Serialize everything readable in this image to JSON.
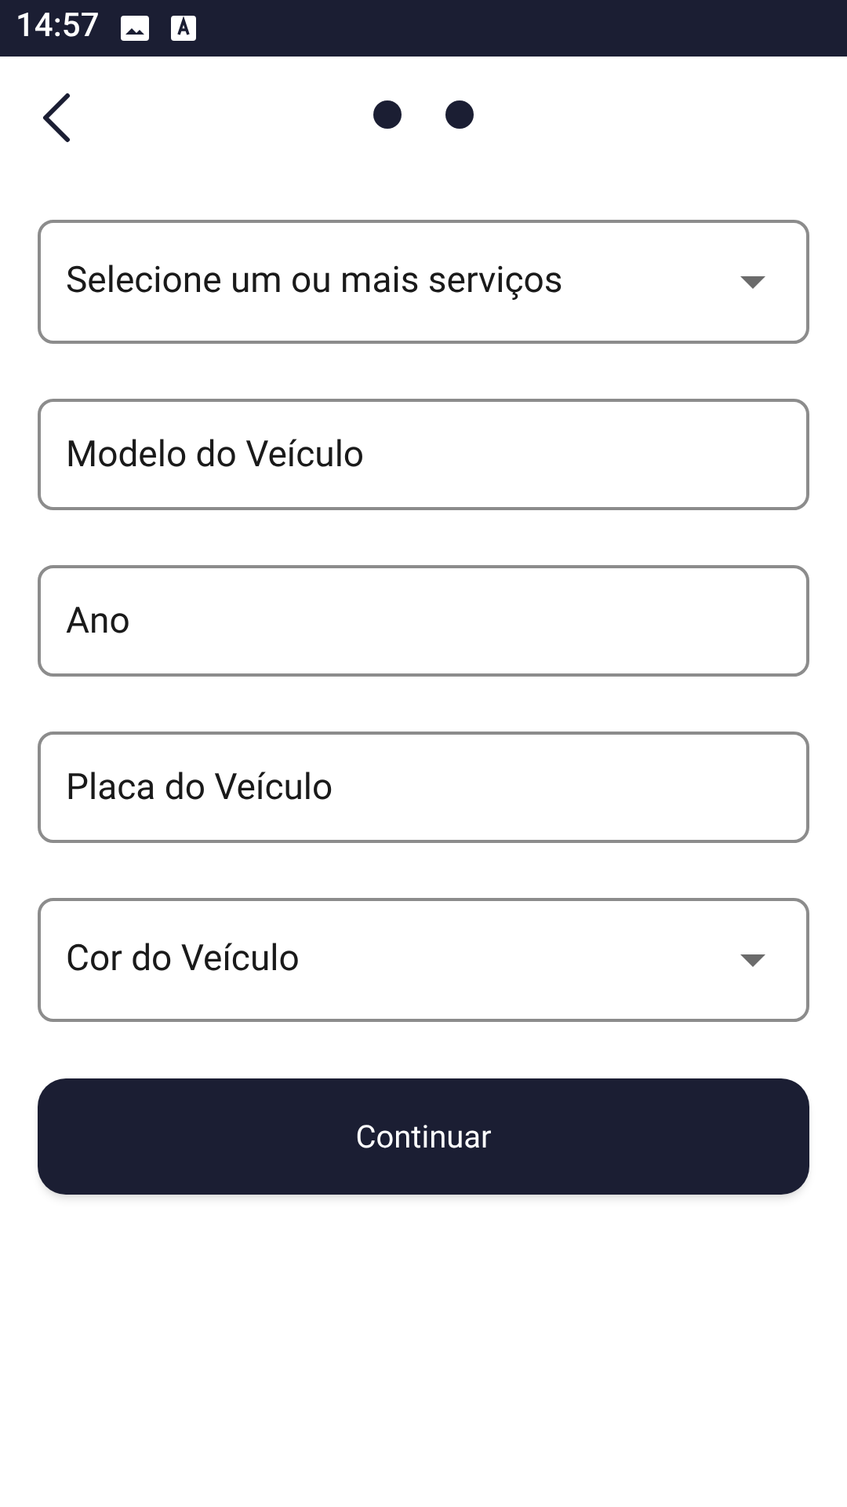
{
  "status_bar": {
    "time": "14:57"
  },
  "fields": [
    {
      "kind": "dropdown",
      "placeholder": "Selecione um ou mais serviços"
    },
    {
      "kind": "text",
      "placeholder": "Modelo do Veículo"
    },
    {
      "kind": "text",
      "placeholder": "Ano"
    },
    {
      "kind": "text",
      "placeholder": "Placa do Veículo"
    },
    {
      "kind": "dropdown",
      "placeholder": "Cor do Veículo"
    }
  ],
  "button": "Continuar"
}
